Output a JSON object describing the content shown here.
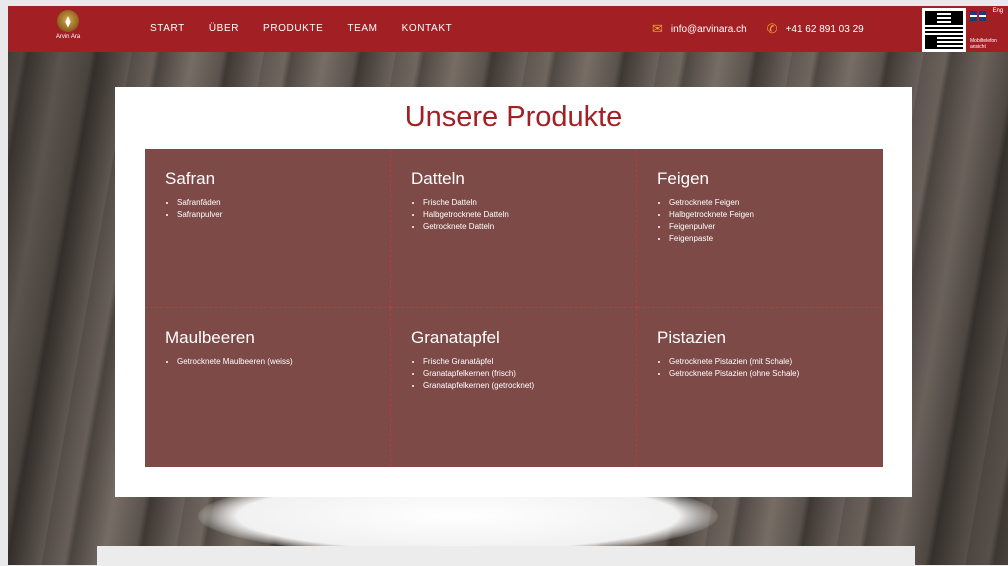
{
  "nav": {
    "logo_text": "Arvin Ara",
    "menu": [
      "START",
      "ÜBER",
      "PRODUKTE",
      "TEAM",
      "KONTAKT"
    ],
    "email": "info@arvinara.ch",
    "phone": "+41 62 891 03 29",
    "language_label": "Eng",
    "mobile_note": "Mobiltelefon ansicht"
  },
  "page": {
    "title": "Unsere Produkte"
  },
  "products": [
    {
      "name": "Safran",
      "items": [
        "Safranfäden",
        "Safranpulver"
      ]
    },
    {
      "name": "Datteln",
      "items": [
        "Frische Datteln",
        "Halbgetrocknete Datteln",
        "Getrocknete Datteln"
      ]
    },
    {
      "name": "Feigen",
      "items": [
        "Getrocknete Feigen",
        "Halbgetrocknete Feigen",
        "Feigenpulver",
        "Feigenpaste"
      ]
    },
    {
      "name": "Maulbeeren",
      "items": [
        "Getrocknete Maulbeeren (weiss)"
      ]
    },
    {
      "name": "Granatapfel",
      "items": [
        "Frische Granatäpfel",
        "Granatapfelkernen (frisch)",
        "Granatapfelkernen (getrocknet)"
      ]
    },
    {
      "name": "Pistazien",
      "items": [
        "Getrocknete Pistazien (mit Schale)",
        "Getrocknete Pistazien (ohne Schale)"
      ]
    }
  ],
  "colors": {
    "nav_bg": "#a21f23",
    "accent_icon": "#f0a030",
    "tile_bg": "#7d4a48",
    "title": "#a21f23"
  },
  "icons": {
    "email": "mail-icon",
    "phone": "phone-icon",
    "language": "uk-flag-icon",
    "qr": "qr-code-icon"
  }
}
